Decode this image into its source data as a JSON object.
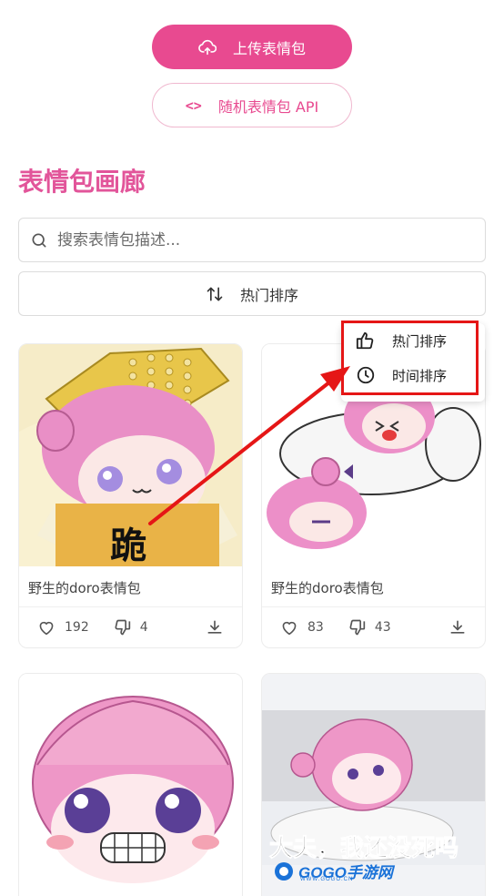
{
  "header": {
    "upload_label": "上传表情包",
    "api_icon_text": "<>",
    "api_label": "随机表情包 API"
  },
  "gallery": {
    "title": "表情包画廊",
    "search_placeholder": "搜索表情包描述...",
    "sort_label": "热门排序"
  },
  "sort_menu": {
    "options": [
      {
        "label": "热门排序",
        "icon": "thumbs-up-icon"
      },
      {
        "label": "时间排序",
        "icon": "clock-icon"
      }
    ]
  },
  "cards": [
    {
      "caption": "野生的doro表情包",
      "likes": "192",
      "dislikes": "4",
      "overlay_text": "跪"
    },
    {
      "caption": "野生的doro表情包",
      "likes": "83",
      "dislikes": "43"
    },
    {
      "caption": ""
    },
    {
      "caption": "",
      "overlay_text": "大夫，我还没死吗"
    }
  ],
  "watermark": {
    "text": "GOGO手游网",
    "sub": "WWW.GOGO.CN"
  },
  "colors": {
    "accent": "#e84a90",
    "title": "#e2559a",
    "annotation": "#e51616"
  }
}
